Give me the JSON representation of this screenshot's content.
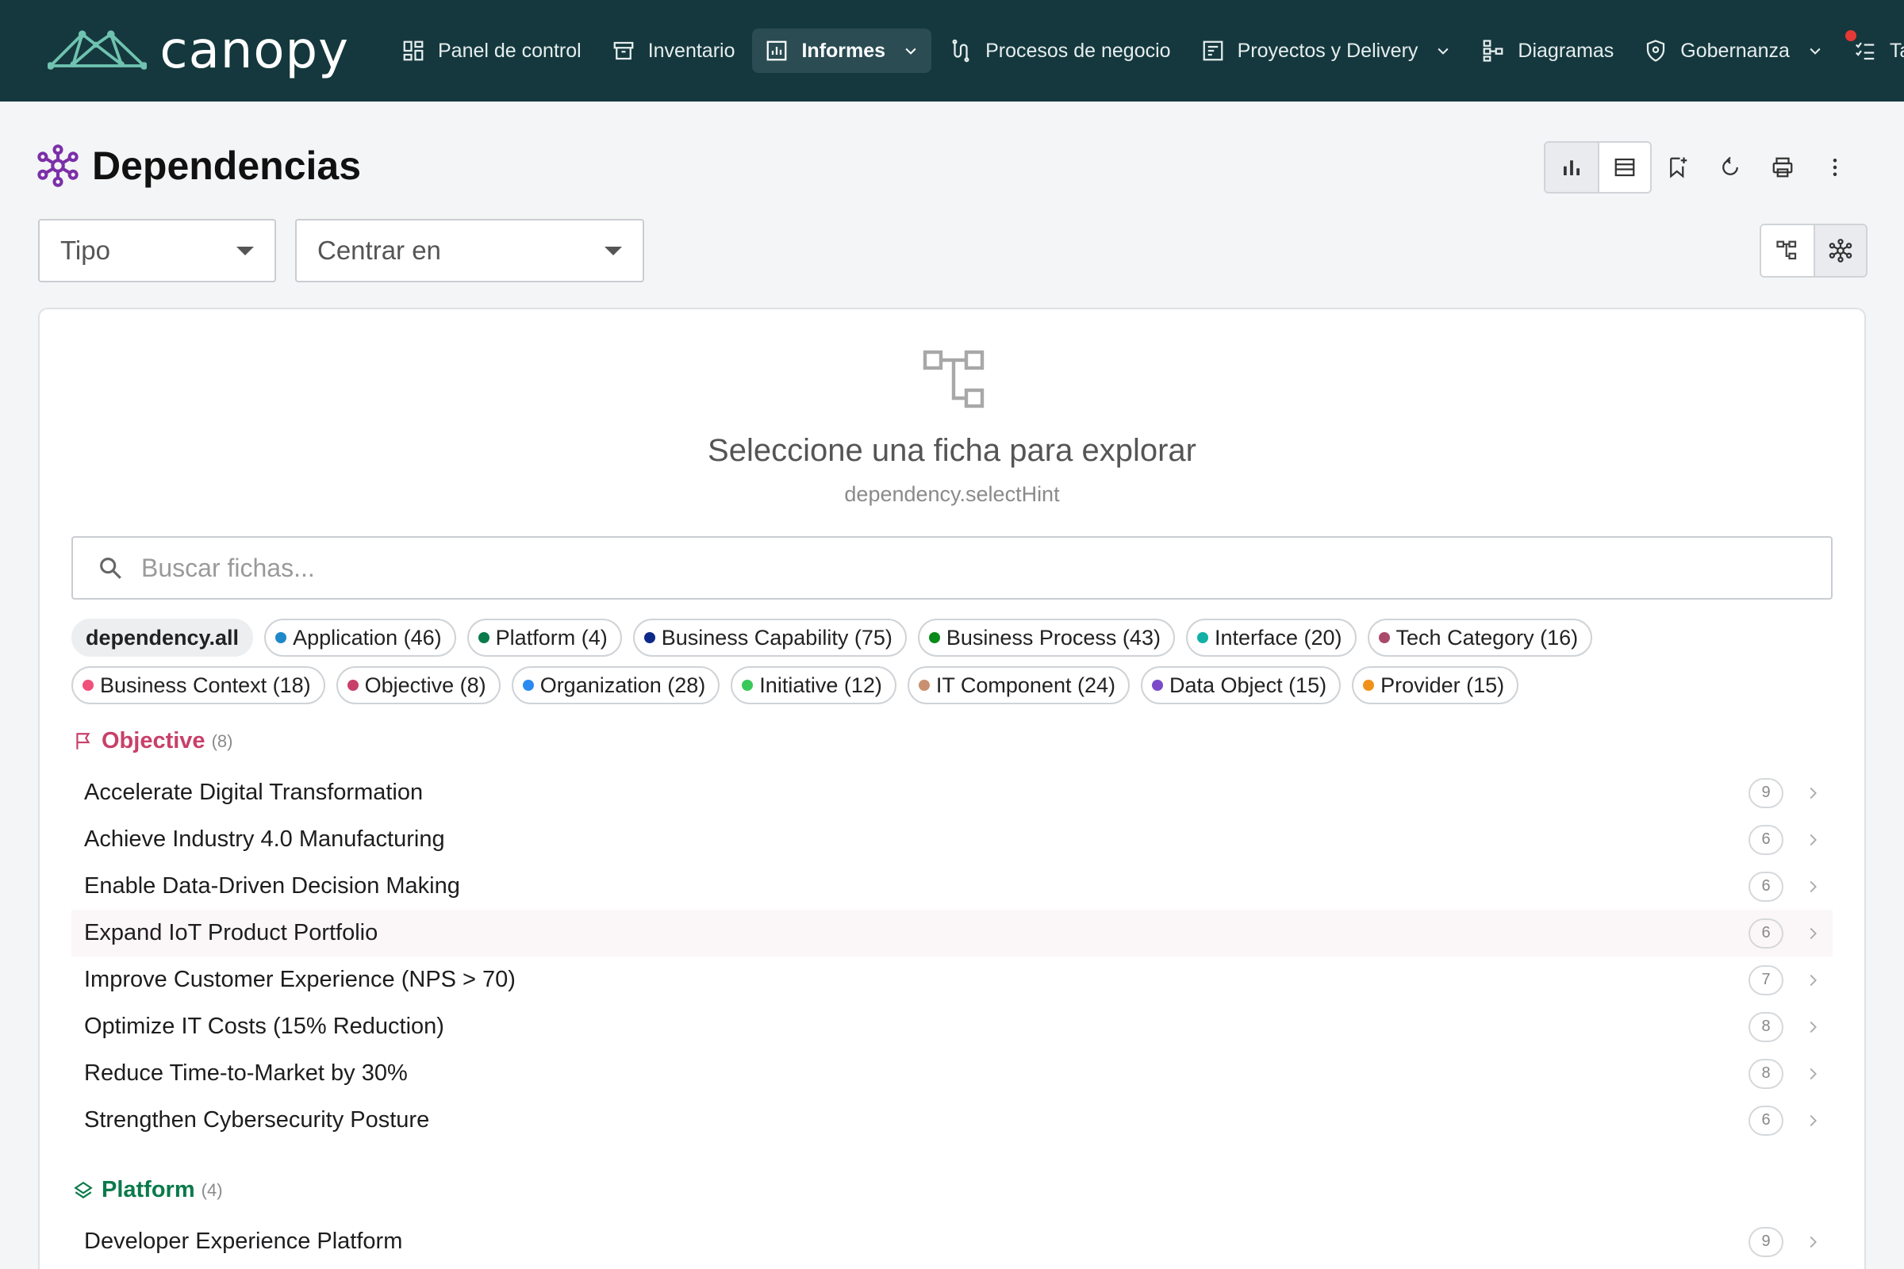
{
  "app": {
    "logo_text": "canopy"
  },
  "nav": {
    "items": [
      {
        "label": "Panel de control",
        "icon": "dashboard-icon"
      },
      {
        "label": "Inventario",
        "icon": "archive-icon"
      },
      {
        "label": "Informes",
        "icon": "report-icon",
        "active": true,
        "dropdown": true
      },
      {
        "label": "Procesos de negocio",
        "icon": "process-icon"
      },
      {
        "label": "Proyectos y Delivery",
        "icon": "project-icon",
        "dropdown": true
      },
      {
        "label": "Diagramas",
        "icon": "diagram-icon"
      },
      {
        "label": "Gobernanza",
        "icon": "shield-icon",
        "dropdown": true
      },
      {
        "label": "Tare",
        "icon": "tasks-icon"
      }
    ]
  },
  "page": {
    "title": "Dependencias"
  },
  "filters": {
    "type_label": "Tipo",
    "center_label": "Centrar en"
  },
  "empty": {
    "title": "Seleccione una ficha para explorar",
    "hint": "dependency.selectHint"
  },
  "search": {
    "placeholder": "Buscar fichas..."
  },
  "chips": {
    "row1": [
      {
        "label": "dependency.all",
        "all": true
      },
      {
        "label": "Application (46)",
        "color": "#1e88c8"
      },
      {
        "label": "Platform (4)",
        "color": "#0a7a4a"
      },
      {
        "label": "Business Capability (75)",
        "color": "#0d2a8a"
      },
      {
        "label": "Business Process (43)",
        "color": "#0a8a1a"
      },
      {
        "label": "Interface (20)",
        "color": "#12b0a6"
      },
      {
        "label": "Tech Category (16)",
        "color": "#a94a6a"
      }
    ],
    "row2": [
      {
        "label": "Business Context (18)",
        "color": "#f0507a"
      },
      {
        "label": "Objective (8)",
        "color": "#c8406a"
      },
      {
        "label": "Organization (28)",
        "color": "#2a8af0"
      },
      {
        "label": "Initiative (12)",
        "color": "#3ac85a"
      },
      {
        "label": "IT Component (24)",
        "color": "#c89070"
      },
      {
        "label": "Data Object (15)",
        "color": "#7a4ac8"
      },
      {
        "label": "Provider (15)",
        "color": "#f0921a"
      }
    ]
  },
  "groups": {
    "objective": {
      "title": "Objective",
      "count": "(8)",
      "color": "#c8406a",
      "items": [
        {
          "label": "Accelerate Digital Transformation",
          "count": "9"
        },
        {
          "label": "Achieve Industry 4.0 Manufacturing",
          "count": "6"
        },
        {
          "label": "Enable Data-Driven Decision Making",
          "count": "6"
        },
        {
          "label": "Expand IoT Product Portfolio",
          "count": "6"
        },
        {
          "label": "Improve Customer Experience (NPS > 70)",
          "count": "7"
        },
        {
          "label": "Optimize IT Costs (15% Reduction)",
          "count": "8"
        },
        {
          "label": "Reduce Time-to-Market by 30%",
          "count": "8"
        },
        {
          "label": "Strengthen Cybersecurity Posture",
          "count": "6"
        }
      ]
    },
    "platform": {
      "title": "Platform",
      "count": "(4)",
      "color": "#0a7a4a",
      "items": [
        {
          "label": "Developer Experience Platform",
          "count": "9"
        }
      ]
    }
  }
}
